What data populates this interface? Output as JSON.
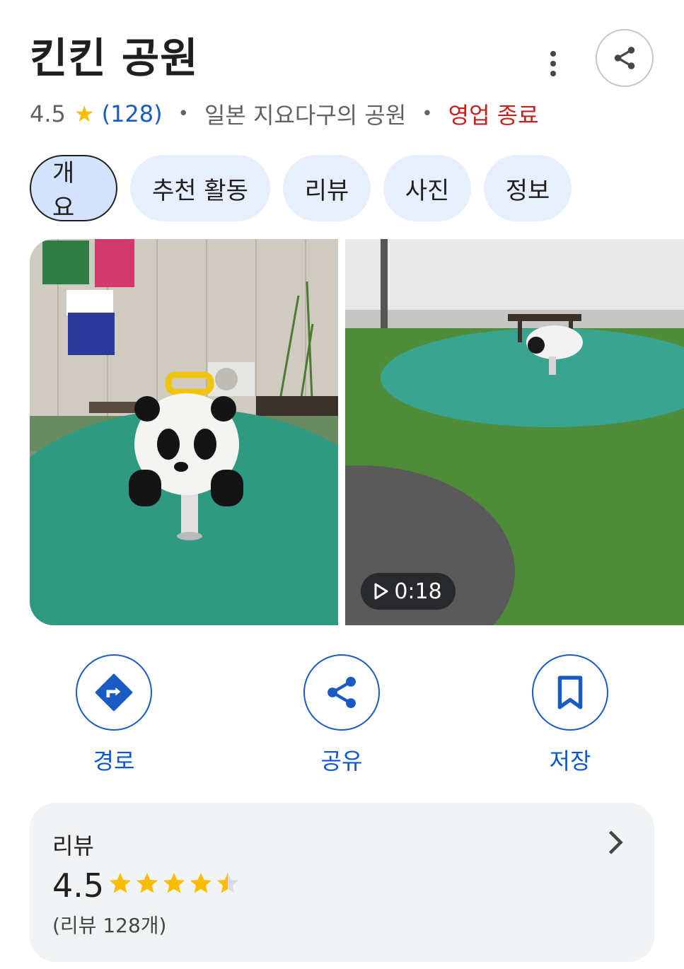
{
  "place": {
    "title": "킨킨 공원",
    "rating": "4.5",
    "review_count": "(128)",
    "category": "일본 지요다구의 공원",
    "status": "영업 종료",
    "status_color": "#c5221f"
  },
  "header": {
    "more_icon": "more-vert-icon",
    "share_icon": "share-icon"
  },
  "tabs": [
    {
      "label": "개요",
      "active": true
    },
    {
      "label": "추천 활동",
      "active": false
    },
    {
      "label": "리뷰",
      "active": false
    },
    {
      "label": "사진",
      "active": false
    },
    {
      "label": "정보",
      "active": false
    }
  ],
  "media": {
    "photo_desc_icon": "photo-icon",
    "video_duration": "0:18"
  },
  "actions": [
    {
      "label": "경로",
      "icon": "directions-icon"
    },
    {
      "label": "공유",
      "icon": "share-icon"
    },
    {
      "label": "저장",
      "icon": "bookmark-icon"
    }
  ],
  "reviews": {
    "title": "리뷰",
    "score": "4.5",
    "stars_value": 4.5,
    "stars_max": 5,
    "count_text": "(리뷰 128개)"
  },
  "colors": {
    "accent": "#0b57d0",
    "star": "#fbbc04",
    "chip_bg": "#e8effc",
    "chip_active_bg": "#d3e3fd"
  }
}
